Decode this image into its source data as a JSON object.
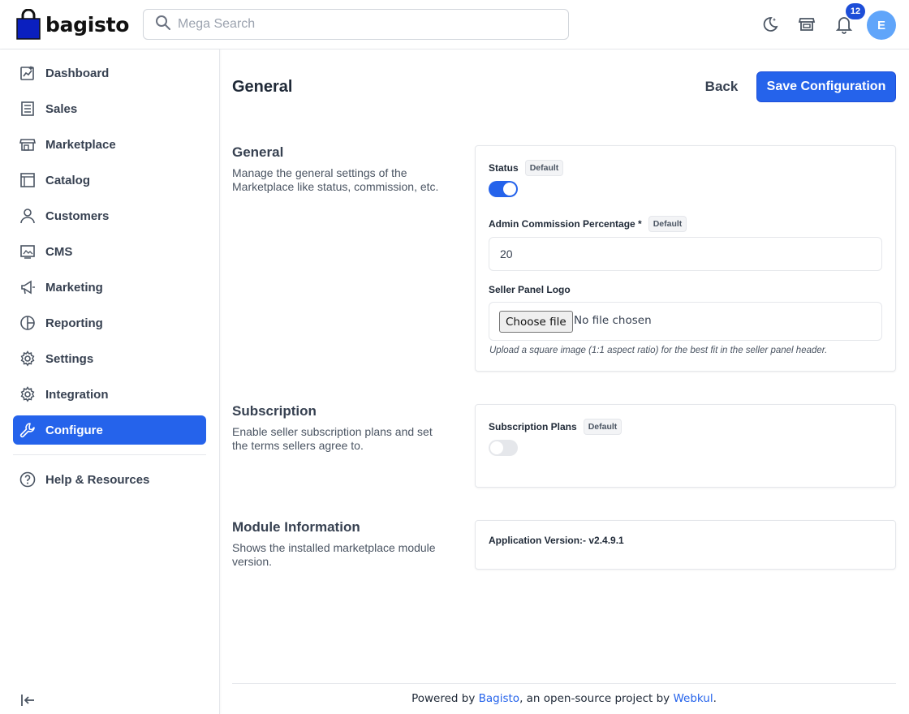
{
  "brand": {
    "name": "bagisto",
    "accent": "#2563eb"
  },
  "search": {
    "placeholder": "Mega Search"
  },
  "header": {
    "icons": [
      "moon-icon",
      "store-icon",
      "bell-icon"
    ],
    "notification_count": "12",
    "avatar_initial": "E"
  },
  "sidebar": {
    "items": [
      {
        "label": "Dashboard",
        "icon": "dashboard-icon"
      },
      {
        "label": "Sales",
        "icon": "sales-icon"
      },
      {
        "label": "Marketplace",
        "icon": "marketplace-icon"
      },
      {
        "label": "Catalog",
        "icon": "catalog-icon"
      },
      {
        "label": "Customers",
        "icon": "customers-icon"
      },
      {
        "label": "CMS",
        "icon": "cms-icon"
      },
      {
        "label": "Marketing",
        "icon": "megaphone-icon"
      },
      {
        "label": "Reporting",
        "icon": "pie-chart-icon"
      },
      {
        "label": "Settings",
        "icon": "gear-icon"
      },
      {
        "label": "Integration",
        "icon": "gear-icon"
      },
      {
        "label": "Configure",
        "icon": "wrench-icon",
        "active": true
      }
    ],
    "help_label": "Help & Resources"
  },
  "page": {
    "title": "General",
    "back_label": "Back",
    "save_label": "Save Configuration"
  },
  "sections": {
    "general": {
      "title": "General",
      "description": "Manage the general settings of the Marketplace like status, commission, etc.",
      "status_label": "Status",
      "status_tag": "Default",
      "status_enabled": true,
      "commission_label": "Admin Commission Percentage *",
      "commission_tag": "Default",
      "commission_value": "20",
      "logo_label": "Seller Panel Logo",
      "file_button": "Choose file",
      "file_status": "No file chosen",
      "logo_hint": "Upload a square image (1:1 aspect ratio) for the best fit in the seller panel header."
    },
    "subscription": {
      "title": "Subscription",
      "description": "Enable seller subscription plans and set the terms sellers agree to.",
      "plans_label": "Subscription Plans",
      "plans_tag": "Default",
      "plans_enabled": false
    },
    "module": {
      "title": "Module Information",
      "description": "Shows the installed marketplace module version.",
      "version_text": "Application Version:- v2.4.9.1"
    }
  },
  "footer": {
    "prefix": "Powered by ",
    "link1": "Bagisto",
    "middle": ", an open-source project by ",
    "link2": "Webkul",
    "suffix": "."
  }
}
